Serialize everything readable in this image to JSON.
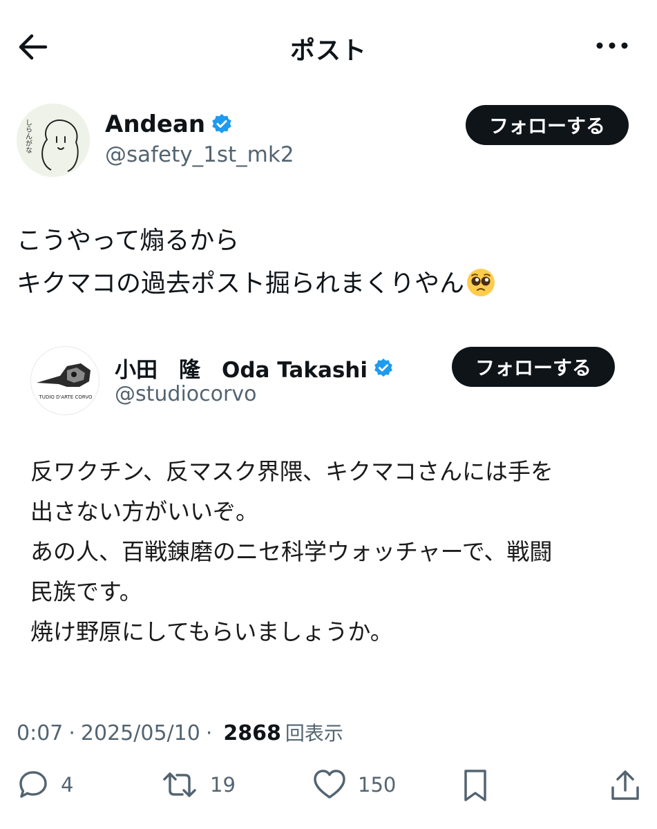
{
  "header": {
    "title": "ポスト",
    "back_icon": "arrow-left-icon",
    "more_icon": "more-horizontal-icon"
  },
  "author": {
    "name": "Andean",
    "handle": "@safety_1st_mk2",
    "avatar_text": "しらんがな",
    "verified": true,
    "follow_label": "フォローする"
  },
  "post": {
    "lines": [
      "こうやって煽るから",
      "キクマコの過去ポスト掘られまくりやん"
    ],
    "emoji": "pleading-face-emoji"
  },
  "quote": {
    "name": "小田　隆　Oda Takashi",
    "handle": "@studiocorvo",
    "avatar_text": "TUDIO D'ARTE CORVO",
    "verified": true,
    "follow_label": "フォローする",
    "lines": [
      "反ワクチン、反マスク界隈、キクマコさんには手を",
      "出さない方がいいぞ。",
      "あの人、百戦錬磨のニセ科学ウォッチャーで、戦闘",
      "民族です。",
      "焼け野原にしてもらいましょうか。"
    ]
  },
  "meta": {
    "time": "0:07",
    "sep1": "·",
    "date": "2025/05/10",
    "sep2": "·",
    "views": "2868",
    "views_label": "回表示"
  },
  "actions": {
    "replies": "4",
    "reposts": "19",
    "likes": "150"
  },
  "colors": {
    "verified": "#1d9bf0",
    "text": "#0f1419",
    "secondary": "#536471",
    "button_bg": "#0f1419"
  }
}
